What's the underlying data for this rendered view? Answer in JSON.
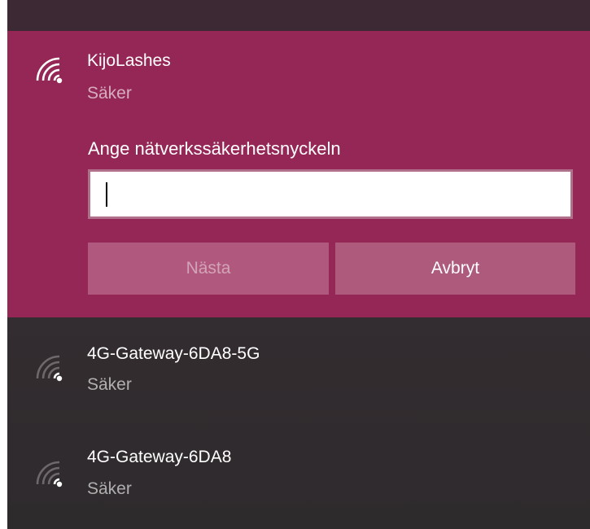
{
  "colors": {
    "accent": "#942756",
    "flyout_background": "#352c31",
    "button_background": "#b0587e",
    "input_border": "#b0708c"
  },
  "selected_network": {
    "name": "KijoLashes",
    "status": "Säker",
    "icon": "wifi-secured-icon",
    "key_prompt": "Ange nätverkssäkerhetsnyckeln",
    "key_value": "",
    "next_label": "Nästa",
    "cancel_label": "Avbryt"
  },
  "networks": [
    {
      "name": "4G-Gateway-6DA8-5G",
      "status": "Säker",
      "icon": "wifi-secured-icon"
    },
    {
      "name": "4G-Gateway-6DA8",
      "status": "Säker",
      "icon": "wifi-secured-icon"
    }
  ]
}
